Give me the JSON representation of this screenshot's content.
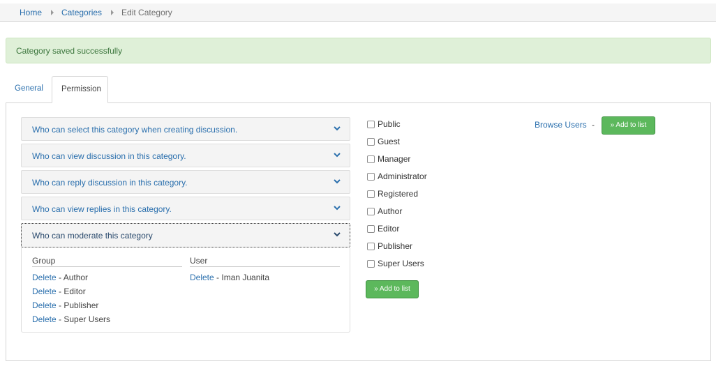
{
  "breadcrumb": {
    "home": "Home",
    "categories": "Categories",
    "current": "Edit Category"
  },
  "alert": {
    "message": "Category saved successfully",
    "color": "#dff0d8"
  },
  "tabs": {
    "general": "General",
    "permission": "Permission",
    "active": "Permission"
  },
  "accordion": [
    {
      "label": "Who can select this category when creating discussion."
    },
    {
      "label": "Who can view discussion in this category."
    },
    {
      "label": "Who can reply discussion in this category."
    },
    {
      "label": "Who can view replies in this category."
    },
    {
      "label": "Who can moderate this category"
    }
  ],
  "moderate": {
    "group_header": "Group",
    "user_header": "User",
    "delete_label": "Delete",
    "groups": [
      {
        "name": "- Author"
      },
      {
        "name": "- Editor"
      },
      {
        "name": "- Publisher"
      },
      {
        "name": "- Super Users"
      }
    ],
    "users": [
      {
        "name": "- Iman Juanita"
      }
    ]
  },
  "groups_checklist": [
    {
      "label": "Public",
      "checked": false
    },
    {
      "label": "Guest",
      "checked": false
    },
    {
      "label": "Manager",
      "checked": false
    },
    {
      "label": "Administrator",
      "checked": false
    },
    {
      "label": "Registered",
      "checked": false
    },
    {
      "label": "Author",
      "checked": false
    },
    {
      "label": "Editor",
      "checked": false
    },
    {
      "label": "Publisher",
      "checked": false
    },
    {
      "label": "Super Users",
      "checked": false
    }
  ],
  "buttons": {
    "add_to_list": "» Add to list",
    "browse_users": "Browse Users",
    "separator": "-"
  },
  "icons": {
    "chevron": "chevron-down-icon",
    "breadcrumb_separator": "caret-right-icon"
  },
  "colors": {
    "link": "#2a6fad",
    "button_green": "#5cb85c"
  }
}
